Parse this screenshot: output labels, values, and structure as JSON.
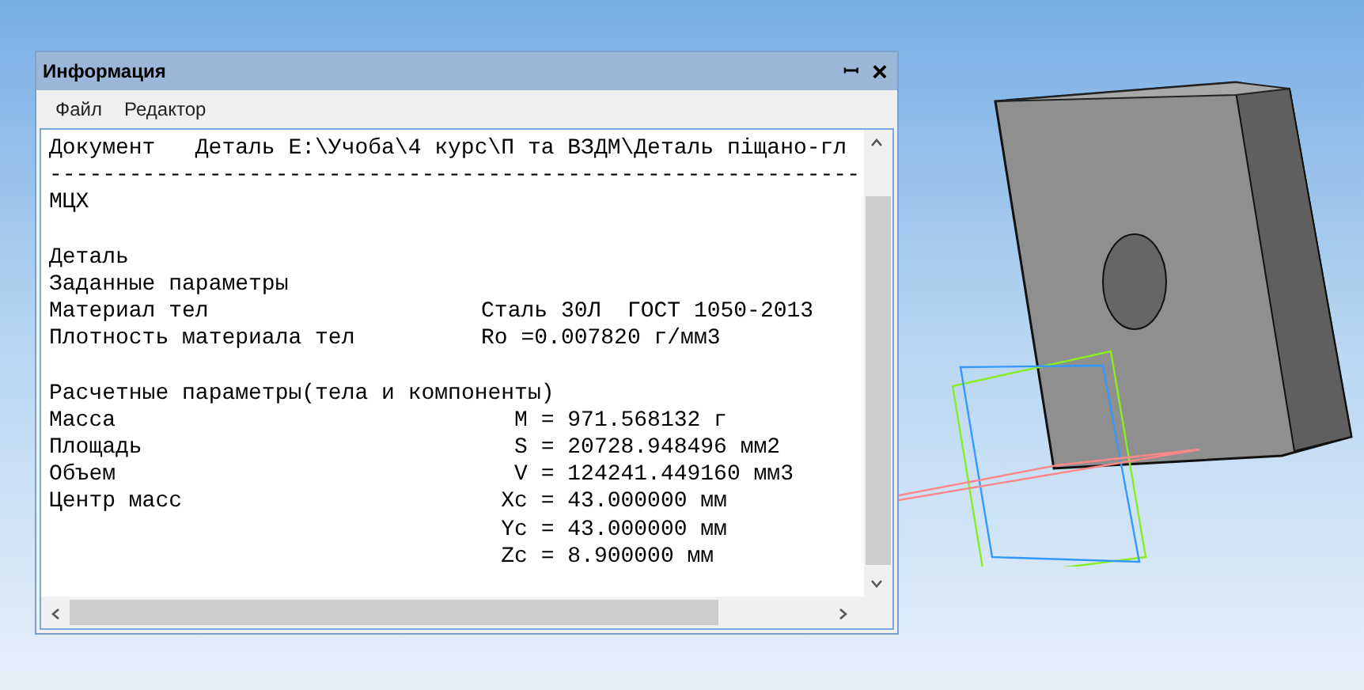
{
  "window": {
    "title": "Информация",
    "pin": "ꟷ",
    "close": "×"
  },
  "menu": [
    {
      "label": "Файл"
    },
    {
      "label": "Редактор"
    }
  ],
  "report": [
    {
      "kind": "header",
      "label": "Документ",
      "value": "Деталь E:\\Учоба\\4 курс\\П та ВЗДМ\\Деталь піщано-гл"
    },
    {
      "kind": "rule",
      "label": "-------------------------------------------------------------"
    },
    {
      "kind": "text",
      "label": "МЦХ"
    },
    {
      "kind": "blank"
    },
    {
      "kind": "text",
      "label": "Деталь"
    },
    {
      "kind": "text",
      "label": "Заданные параметры"
    },
    {
      "kind": "param",
      "label": "Материал тел",
      "value": "Сталь 30Л  ГОСТ 1050-2013"
    },
    {
      "kind": "param",
      "label": "Плотность материала тел",
      "value": "Ro =0.007820 г/мм3"
    },
    {
      "kind": "blank"
    },
    {
      "kind": "text",
      "label": "Расчетные параметры(тела и компоненты)"
    },
    {
      "kind": "result",
      "label": "Масса",
      "symbol": "M",
      "value": "= 971.568132 г"
    },
    {
      "kind": "result",
      "label": "Площадь",
      "symbol": "S",
      "value": "= 20728.948496 мм2"
    },
    {
      "kind": "result",
      "label": "Объем",
      "symbol": "V",
      "value": "= 124241.449160 мм3"
    },
    {
      "kind": "result",
      "label": "Центр масс",
      "symbol": "Xc",
      "value": "= 43.000000 мм"
    },
    {
      "kind": "result",
      "symbol": "Yc",
      "value": "= 43.000000 мм"
    },
    {
      "kind": "result",
      "symbol": "Zc",
      "value": "= 8.900000 мм"
    }
  ]
}
